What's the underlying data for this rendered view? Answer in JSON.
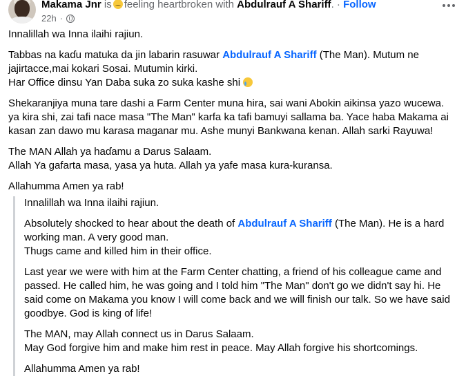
{
  "post": {
    "author": "Makama Jnr",
    "is_text": "is",
    "feeling_text": "feeling heartbroken with",
    "tagged": "Abdulrauf A Shariff",
    "separator": ".",
    "dot": "·",
    "follow_label": "Follow",
    "time": "22h",
    "dot2": "·"
  },
  "hausa": {
    "p1": "Innalillah wa Inna ilaihi rajiun.",
    "p2_before": "Tabbas na kaɗu matuka da jin labarin rasuwar ",
    "p2_mention": "Abdulrauf A Shariff",
    "p2_after": " (The Man). Mutum ne jajirtacce,mai kokari Sosai. Mutumin kirki.\nHar Office dinsu Yan Daba suka zo suka kashe shi ",
    "p3": "Shekaranjiya muna tare dashi a Farm Center muna hira, sai wani Abokin aikinsa yazo wucewa. ya kira shi, zai tafi nace masa \"The Man\" karfa ka tafi bamuyi sallama ba. Yace haba Makama ai kasan zan dawo mu karasa maganar mu. Ashe munyi Bankwana kenan. Allah sarki Rayuwa!",
    "p4": "The MAN Allah ya haɗamu a Darus Salaam.\nAllah Ya gafarta masa, yasa ya huta. Allah ya yafe masa kura-kuransa.",
    "p5": "Allahumma Amen ya rab!"
  },
  "english": {
    "p1": "Innalillah wa Inna ilaihi rajiun.",
    "p2_before": "Absolutely shocked to hear about the death of ",
    "p2_mention": "Abdulrauf A Shariff",
    "p2_after": " (The Man). He is a hard working man. A very good man.\nThugs came and killed him in their office.",
    "p3": "Last year we were with him at the Farm Center chatting, a friend of his colleague came and passed. He called him, he was going and I told him \"The Man\" don't go we didn't say hi. He said come on Makama you know I will come back and we will finish our talk. So we have said goodbye. God is king of life!",
    "p4": "The MAN, may Allah connect us in Darus Salaam.\nMay God forgive him and make him rest in peace. May Allah forgive his shortcomings.",
    "p5": "Allahumma Amen ya rab!"
  },
  "colors": {
    "link": "#0866ff",
    "muted": "#65676b",
    "text": "#050505",
    "quote_bar": "#cfd2d6"
  },
  "icons": [
    "sad-face-emoji-icon",
    "crying-face-emoji-icon",
    "globe-icon",
    "more-options-icon",
    "avatar"
  ]
}
